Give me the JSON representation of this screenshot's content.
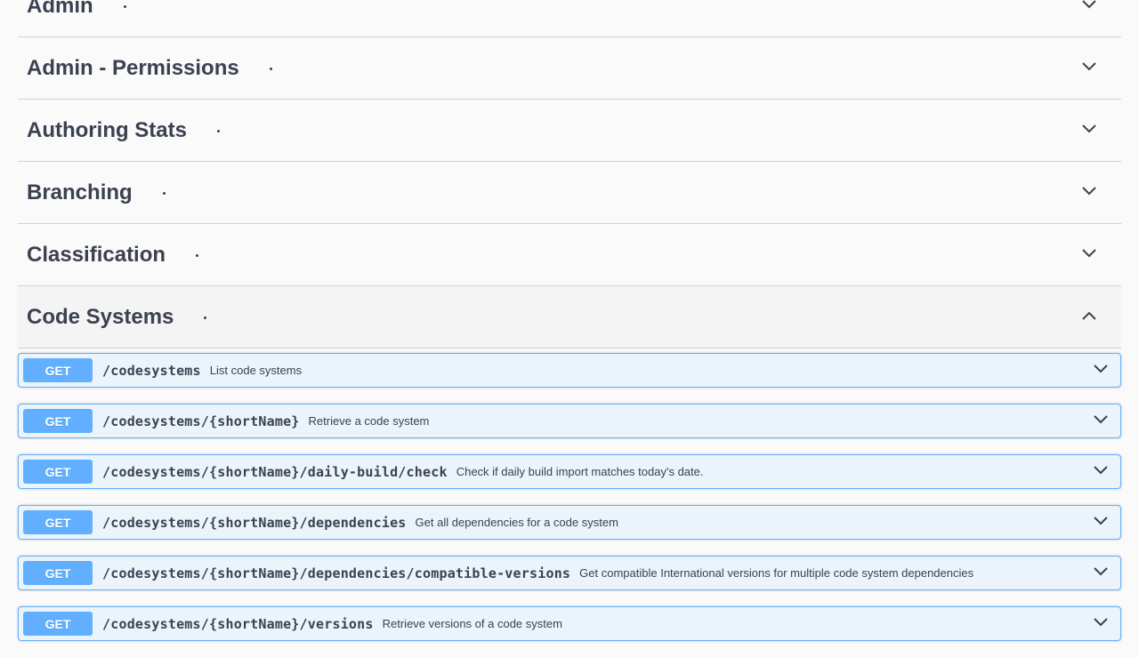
{
  "tags": [
    {
      "name": "Admin",
      "expanded": false
    },
    {
      "name": "Admin - Permissions",
      "expanded": false
    },
    {
      "name": "Authoring Stats",
      "expanded": false
    },
    {
      "name": "Branching",
      "expanded": false
    },
    {
      "name": "Classification",
      "expanded": false
    },
    {
      "name": "Code Systems",
      "expanded": true
    }
  ],
  "operations": [
    {
      "method": "GET",
      "path": "/codesystems",
      "summary": "List code systems"
    },
    {
      "method": "GET",
      "path": "/codesystems/{shortName}",
      "summary": "Retrieve a code system"
    },
    {
      "method": "GET",
      "path": "/codesystems/{shortName}/daily-build/check",
      "summary": "Check if daily build import matches today's date."
    },
    {
      "method": "GET",
      "path": "/codesystems/{shortName}/dependencies",
      "summary": "Get all dependencies for a code system"
    },
    {
      "method": "GET",
      "path": "/codesystems/{shortName}/dependencies/compatible-versions",
      "summary": "Get compatible International versions for multiple code system dependencies"
    },
    {
      "method": "GET",
      "path": "/codesystems/{shortName}/versions",
      "summary": "Retrieve versions of a code system"
    }
  ],
  "colors": {
    "get_accent": "#61affe",
    "get_background": "#ebf3fb",
    "text": "#3b4151"
  },
  "icons": {
    "collapsed": "chevron-down-icon",
    "expanded": "chevron-up-icon"
  }
}
